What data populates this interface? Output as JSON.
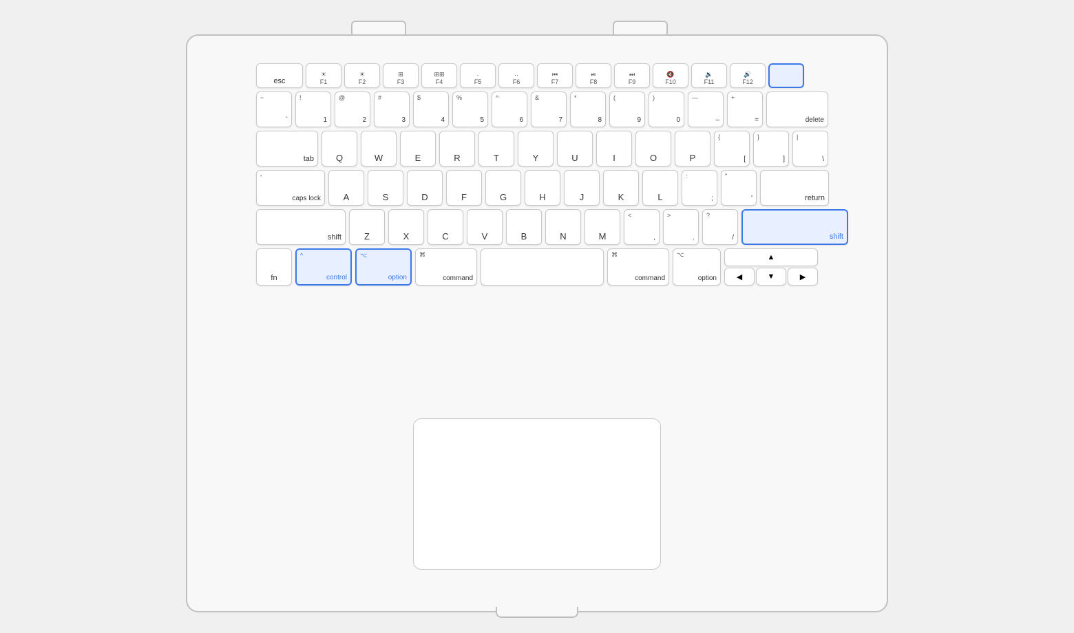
{
  "laptop": {
    "keyboard": {
      "row_fn": {
        "keys": [
          {
            "id": "esc",
            "label": "esc",
            "type": "esc"
          },
          {
            "id": "f1",
            "top": "☀",
            "bottom": "F1",
            "type": "fn"
          },
          {
            "id": "f2",
            "top": "☀",
            "bottom": "F2",
            "type": "fn"
          },
          {
            "id": "f3",
            "top": "⊞",
            "bottom": "F3",
            "type": "fn"
          },
          {
            "id": "f4",
            "top": "⊞⊞",
            "bottom": "F4",
            "type": "fn"
          },
          {
            "id": "f5",
            "top": "·",
            "bottom": "F5",
            "type": "fn"
          },
          {
            "id": "f6",
            "top": "··",
            "bottom": "F6",
            "type": "fn"
          },
          {
            "id": "f7",
            "top": "◁◁",
            "bottom": "F7",
            "type": "fn"
          },
          {
            "id": "f8",
            "top": "▷||",
            "bottom": "F8",
            "type": "fn"
          },
          {
            "id": "f9",
            "top": "▷▷",
            "bottom": "F9",
            "type": "fn"
          },
          {
            "id": "f10",
            "top": "◁",
            "bottom": "F10",
            "type": "fn"
          },
          {
            "id": "f11",
            "top": "◁)",
            "bottom": "F11",
            "type": "fn"
          },
          {
            "id": "f12",
            "top": "◁))",
            "bottom": "F12",
            "type": "fn"
          },
          {
            "id": "power",
            "label": "",
            "type": "power",
            "highlighted": true
          }
        ]
      },
      "row_numbers": {
        "keys": [
          {
            "id": "tilde",
            "top": "~",
            "bottom": "`"
          },
          {
            "id": "1",
            "top": "!",
            "bottom": "1"
          },
          {
            "id": "2",
            "top": "@",
            "bottom": "2"
          },
          {
            "id": "3",
            "top": "#",
            "bottom": "3"
          },
          {
            "id": "4",
            "top": "$",
            "bottom": "4"
          },
          {
            "id": "5",
            "top": "%",
            "bottom": "5"
          },
          {
            "id": "6",
            "top": "^",
            "bottom": "6"
          },
          {
            "id": "7",
            "top": "&",
            "bottom": "7"
          },
          {
            "id": "8",
            "top": "*",
            "bottom": "8"
          },
          {
            "id": "9",
            "top": "(",
            "bottom": "9"
          },
          {
            "id": "0",
            "top": ")",
            "bottom": "0"
          },
          {
            "id": "minus",
            "top": "—",
            "bottom": "–"
          },
          {
            "id": "equals",
            "top": "+",
            "bottom": "="
          },
          {
            "id": "delete",
            "label": "delete"
          }
        ]
      },
      "row_qwerty": {
        "tab_label": "tab",
        "keys": [
          "Q",
          "W",
          "E",
          "R",
          "T",
          "Y",
          "U",
          "I",
          "O",
          "P"
        ],
        "bracket_open_top": "{",
        "bracket_open_bottom": "[",
        "bracket_close_top": "}",
        "bracket_close_bottom": "]",
        "pipe_top": "|",
        "pipe_bottom": "\\"
      },
      "row_asdf": {
        "caps_label": "caps lock",
        "dot_top": "•",
        "keys": [
          "A",
          "S",
          "D",
          "F",
          "G",
          "H",
          "J",
          "K",
          "L"
        ],
        "colon_top": ":",
        "colon_bottom": ";",
        "quote_top": "\"",
        "quote_bottom": "'",
        "return_label": "return"
      },
      "row_zxcv": {
        "shift_left_label": "shift",
        "keys": [
          "Z",
          "X",
          "C",
          "V",
          "B",
          "N",
          "M"
        ],
        "lt_top": "<",
        "lt_bottom": ",",
        "gt_top": ">",
        "gt_bottom": ".",
        "slash_top": "?",
        "slash_bottom": "/",
        "shift_right_label": "shift",
        "shift_right_highlighted": true
      },
      "row_bottom": {
        "fn_label": "fn",
        "control_label": "control",
        "control_top": "^",
        "control_highlighted": true,
        "option_label": "option",
        "option_top": "⌥",
        "option_highlighted": true,
        "cmd_left_label": "command",
        "cmd_left_top": "⌘",
        "space_label": "",
        "cmd_right_label": "command",
        "cmd_right_top": "⌘",
        "option_right_label": "option",
        "option_right_top": "⌥"
      }
    }
  }
}
